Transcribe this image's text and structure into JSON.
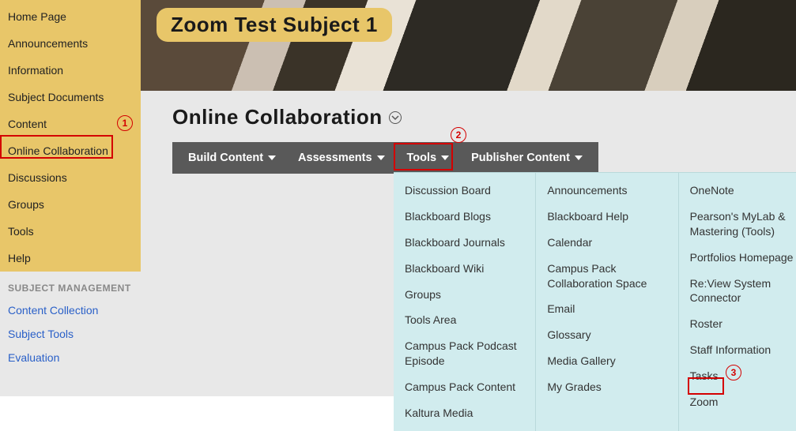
{
  "sidebar": {
    "nav": [
      "Home Page",
      "Announcements",
      "Information",
      "Subject Documents",
      "Content",
      "Online Collaboration",
      "Discussions",
      "Groups",
      "Tools",
      "Help"
    ],
    "mgmt_heading": "SUBJECT MANAGEMENT",
    "mgmt": [
      "Content Collection",
      "Subject Tools",
      "Evaluation"
    ]
  },
  "banner": {
    "title": "Zoom Test Subject 1"
  },
  "page": {
    "title": "Online Collaboration"
  },
  "actionbar": {
    "build_content": "Build Content",
    "assessments": "Assessments",
    "tools": "Tools",
    "publisher_content": "Publisher Content"
  },
  "dropdown": {
    "col1": [
      "Discussion Board",
      "Blackboard Blogs",
      "Blackboard Journals",
      "Blackboard Wiki",
      "Groups",
      "Tools Area",
      "Campus Pack Podcast Episode",
      "Campus Pack Content",
      "Kaltura Media"
    ],
    "col2": [
      "Announcements",
      "Blackboard Help",
      "Calendar",
      "Campus Pack Collaboration Space",
      "Email",
      "Glossary",
      "Media Gallery",
      "My Grades"
    ],
    "col3": [
      "OneNote",
      "Pearson's MyLab & Mastering (Tools)",
      "Portfolios Homepage",
      "Re:View System Connector",
      "Roster",
      "Staff Information",
      "Tasks",
      "Zoom"
    ]
  },
  "annotations": {
    "n1": "1",
    "n2": "2",
    "n3": "3"
  }
}
